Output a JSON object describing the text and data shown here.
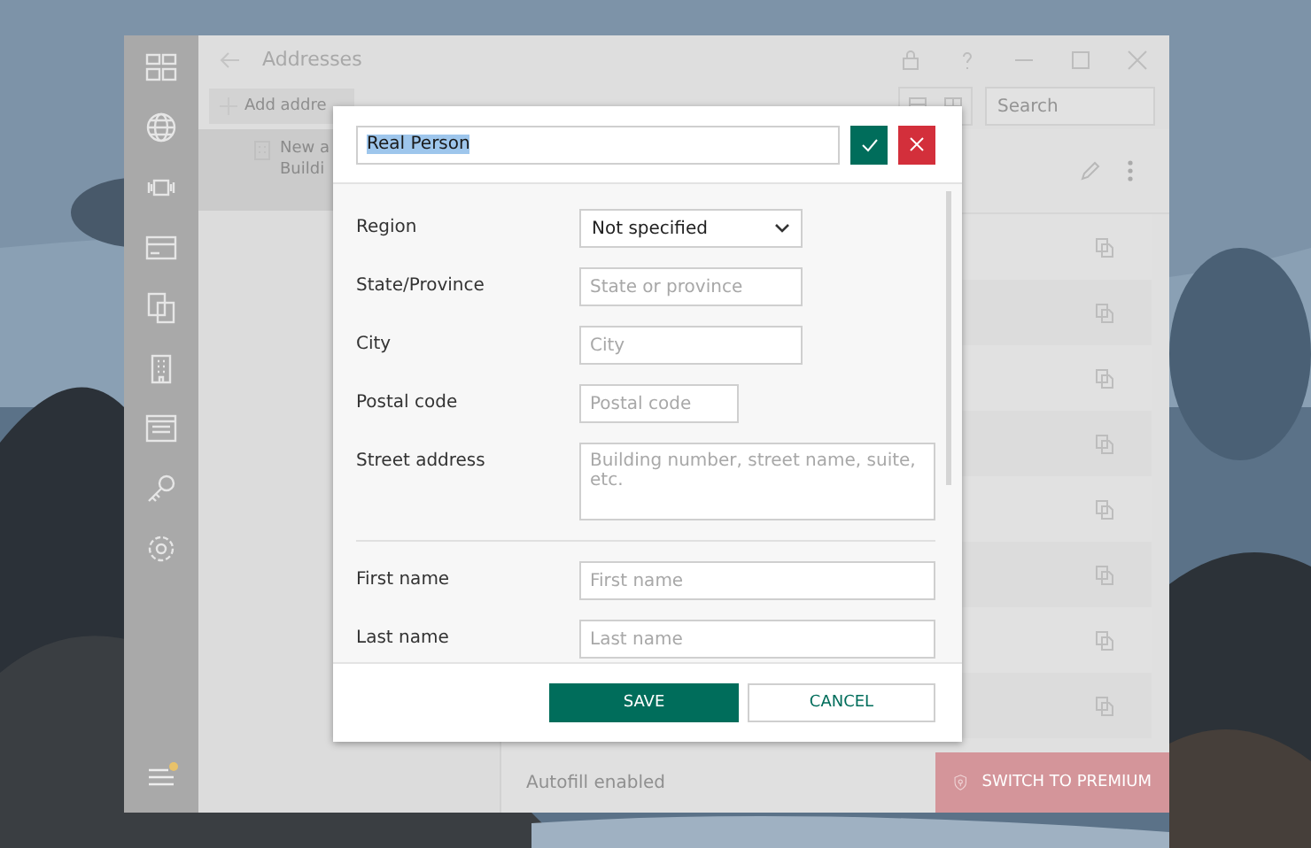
{
  "window": {
    "title": "Addresses"
  },
  "toolbar": {
    "add_button": "Add addre",
    "search": {
      "placeholder": "Search"
    }
  },
  "address_list": [
    {
      "title": "New a",
      "subtitle": "Buildi",
      "selected": true
    }
  ],
  "sidebar": {
    "notification": true
  },
  "status": "Autofill enabled",
  "premium_button": "SWITCH TO PREMIUM",
  "dialog": {
    "name": {
      "value": "Real Person",
      "selected": true
    },
    "fields": [
      {
        "kind": "select",
        "label": "Region",
        "value": "Not specified"
      },
      {
        "kind": "text",
        "label": "State/Province",
        "placeholder": "State or province"
      },
      {
        "kind": "text",
        "label": "City",
        "placeholder": "City"
      },
      {
        "kind": "shorttext",
        "label": "Postal code",
        "placeholder": "Postal code"
      },
      {
        "kind": "textarea",
        "label": "Street address",
        "placeholder": "Building number, street name, suite, etc."
      },
      {
        "kind": "divider"
      },
      {
        "kind": "longtext",
        "label": "First name",
        "placeholder": "First name"
      },
      {
        "kind": "longtext",
        "label": "Last name",
        "placeholder": "Last name"
      }
    ],
    "save": "SAVE",
    "cancel": "CANCEL"
  }
}
